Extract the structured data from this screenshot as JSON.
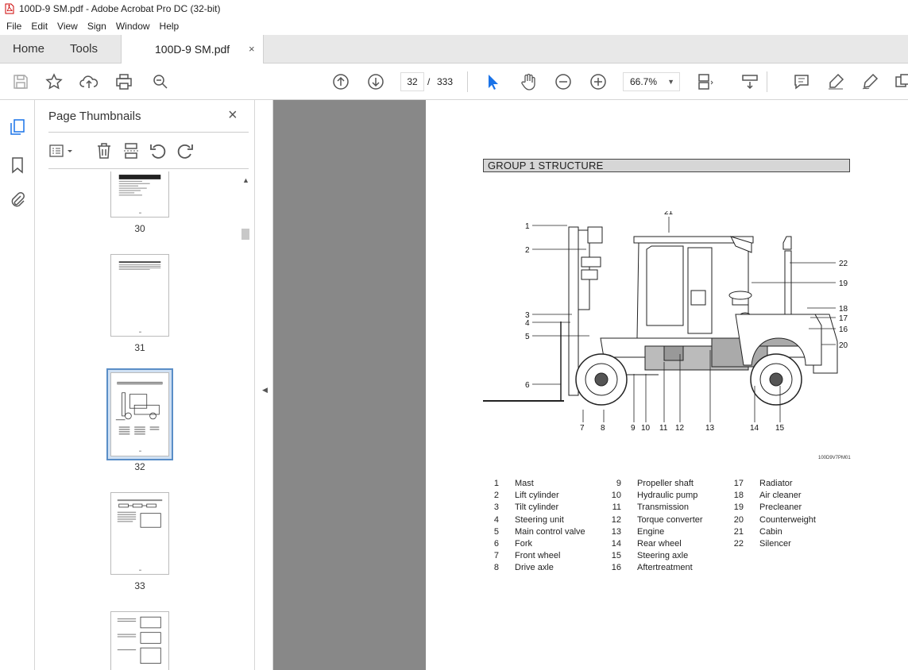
{
  "window": {
    "title": "100D-9 SM.pdf - Adobe Acrobat Pro DC (32-bit)"
  },
  "menu": [
    "File",
    "Edit",
    "View",
    "Sign",
    "Window",
    "Help"
  ],
  "tabs": {
    "home": "Home",
    "tools": "Tools",
    "document": "100D-9 SM.pdf",
    "close": "×"
  },
  "toolbar": {
    "page_current": "32",
    "page_sep": "/",
    "page_total": "333",
    "zoom": "66.7%"
  },
  "panel": {
    "title": "Page Thumbnails",
    "close": "×",
    "thumbnails": [
      {
        "page": "30"
      },
      {
        "page": "31"
      },
      {
        "page": "32",
        "selected": true
      },
      {
        "page": "33"
      }
    ]
  },
  "document": {
    "heading": "GROUP  1  STRUCTURE",
    "figure_code": "100D9V7PM01",
    "callouts": [
      "1",
      "2",
      "3",
      "4",
      "5",
      "6",
      "7",
      "8",
      "9",
      "10",
      "11",
      "12",
      "13",
      "14",
      "15",
      "16",
      "17",
      "18",
      "19",
      "20",
      "21",
      "22"
    ],
    "legend": [
      {
        "n": "1",
        "label": "Mast"
      },
      {
        "n": "2",
        "label": "Lift cylinder"
      },
      {
        "n": "3",
        "label": "Tilt cylinder"
      },
      {
        "n": "4",
        "label": "Steering unit"
      },
      {
        "n": "5",
        "label": "Main control valve"
      },
      {
        "n": "6",
        "label": "Fork"
      },
      {
        "n": "7",
        "label": "Front wheel"
      },
      {
        "n": "8",
        "label": "Drive axle"
      },
      {
        "n": "9",
        "label": "Propeller shaft"
      },
      {
        "n": "10",
        "label": "Hydraulic pump"
      },
      {
        "n": "11",
        "label": "Transmission"
      },
      {
        "n": "12",
        "label": "Torque converter"
      },
      {
        "n": "13",
        "label": "Engine"
      },
      {
        "n": "14",
        "label": "Rear wheel"
      },
      {
        "n": "15",
        "label": "Steering axle"
      },
      {
        "n": "16",
        "label": "Aftertreatment"
      },
      {
        "n": "17",
        "label": "Radiator"
      },
      {
        "n": "18",
        "label": "Air cleaner"
      },
      {
        "n": "19",
        "label": "Precleaner"
      },
      {
        "n": "20",
        "label": "Counterweight"
      },
      {
        "n": "21",
        "label": "Cabin"
      },
      {
        "n": "22",
        "label": "Silencer"
      }
    ]
  },
  "icons": [
    "pdf-icon",
    "save-icon",
    "star-icon",
    "upload-icon",
    "print-icon",
    "zoom-search-icon",
    "page-up-icon",
    "page-down-icon",
    "cursor-icon",
    "hand-icon",
    "zoom-out-icon",
    "zoom-in-icon",
    "fit-page-icon",
    "scroll-mode-icon",
    "comment-icon",
    "highlight-icon",
    "sign-icon",
    "more-icon",
    "thumbnails-icon",
    "bookmark-icon",
    "attachment-icon",
    "options-icon",
    "trash-icon",
    "insert-page-icon",
    "rotate-ccw-icon",
    "rotate-cw-icon"
  ]
}
